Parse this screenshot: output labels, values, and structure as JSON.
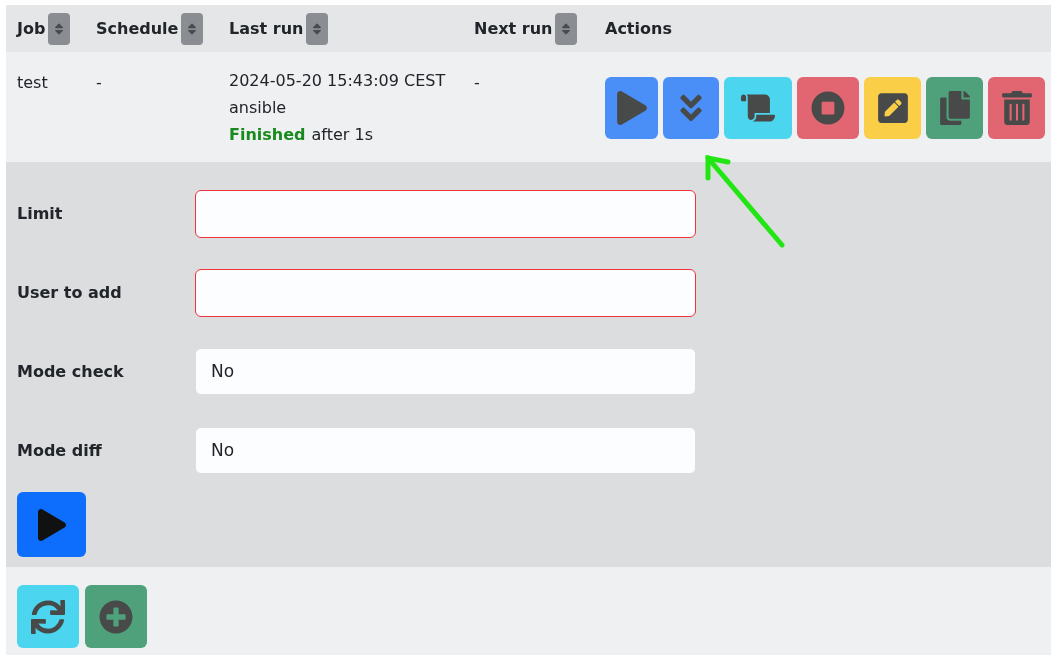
{
  "table": {
    "columns": [
      {
        "label": "Job",
        "sortable": true
      },
      {
        "label": "Schedule",
        "sortable": true
      },
      {
        "label": "Last run",
        "sortable": true
      },
      {
        "label": "Next run",
        "sortable": true
      },
      {
        "label": "Actions",
        "sortable": false
      }
    ],
    "rows": [
      {
        "job": "test",
        "schedule": "-",
        "last_run": {
          "time": "2024-05-20 15:43:09 CEST",
          "user": "ansible",
          "status": "Finished",
          "duration": "after 1s"
        },
        "next_run": "-",
        "actions": [
          {
            "kind": "run"
          },
          {
            "kind": "expand"
          },
          {
            "kind": "logs"
          },
          {
            "kind": "stop"
          },
          {
            "kind": "edit"
          },
          {
            "kind": "copy"
          },
          {
            "kind": "delete"
          }
        ]
      }
    ]
  },
  "form": {
    "fields": [
      {
        "label": "Limit",
        "kind": "text",
        "invalid": true
      },
      {
        "label": "User to add",
        "kind": "text",
        "invalid": true
      },
      {
        "label": "Mode check",
        "kind": "select",
        "value": "No",
        "invalid": false
      },
      {
        "label": "Mode diff",
        "kind": "select",
        "value": "No",
        "invalid": false
      }
    ]
  },
  "footer": {
    "buttons": [
      {
        "kind": "refresh"
      },
      {
        "kind": "add"
      }
    ]
  },
  "annotation": {
    "kind": "arrow"
  }
}
